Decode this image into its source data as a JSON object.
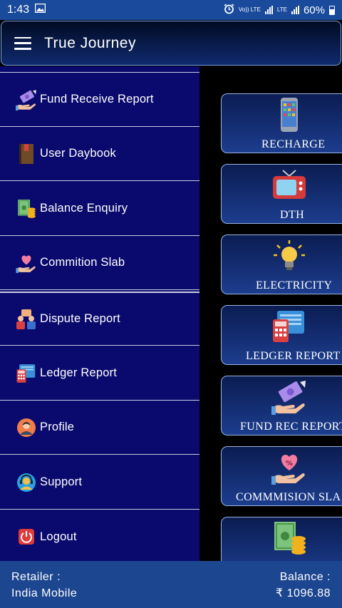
{
  "status_bar": {
    "time": "1:43",
    "volte_label": "Vo)) LTE",
    "lte_label": "LTE",
    "battery": "60%"
  },
  "app_bar": {
    "title": "True Journey"
  },
  "drawer": {
    "items": [
      {
        "label": "Fund Receive Report",
        "icon": "fund-receive-icon"
      },
      {
        "label": "User Daybook",
        "icon": "book-icon"
      },
      {
        "label": "Balance Enquiry",
        "icon": "money-coins-icon"
      },
      {
        "label": "Commition Slab",
        "icon": "commission-hand-icon"
      },
      {
        "label": "Dispute Report",
        "icon": "dispute-people-icon"
      },
      {
        "label": "Ledger Report",
        "icon": "ledger-icon"
      },
      {
        "label": "Profile",
        "icon": "profile-icon"
      },
      {
        "label": "Support",
        "icon": "support-icon"
      },
      {
        "label": "Logout",
        "icon": "power-icon"
      }
    ]
  },
  "tiles": [
    {
      "label": "RECHARGE",
      "icon": "mobile-phone-icon"
    },
    {
      "label": "DTH",
      "icon": "tv-icon"
    },
    {
      "label": "ELECTRICITY",
      "icon": "light-bulb-icon"
    },
    {
      "label": "LEDGER REPORT",
      "icon": "ledger-icon"
    },
    {
      "label": "FUND REC REPORT",
      "icon": "fund-receive-icon"
    },
    {
      "label": "COMMMISION SLA",
      "icon": "commission-hand-icon"
    },
    {
      "label": "",
      "icon": "money-coins-icon"
    }
  ],
  "footer": {
    "retailer_label": "Retailer :",
    "retailer_name": "India Mobile",
    "balance_label": "Balance :",
    "balance_value": "₹ 1096.88"
  }
}
